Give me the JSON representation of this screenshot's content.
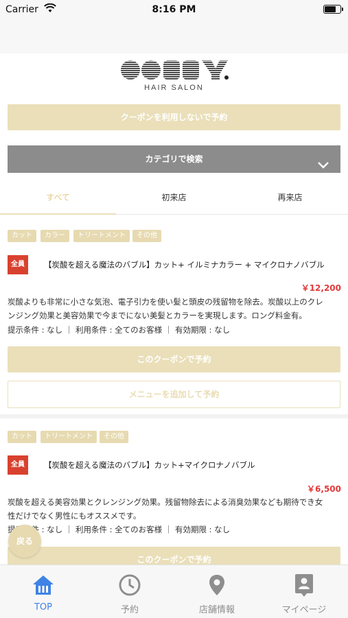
{
  "status": {
    "carrier": "Carrier",
    "time": "8:16 PM"
  },
  "brand": {
    "logo_text": "OORRY.",
    "subtitle": "HAIR SALON"
  },
  "actions": {
    "no_coupon": "クーポンを利用しないで予約",
    "category_search": "カテゴリで検索"
  },
  "tabs": [
    "すべて",
    "初来店",
    "再来店"
  ],
  "coupons": [
    {
      "tags": [
        "カット",
        "カラー",
        "トリートメント",
        "その他"
      ],
      "badge": "全員",
      "title": "【炭酸を超える魔法のバブル】カット+ イルミナカラー + マイクロナノバブル",
      "price": "￥12,200",
      "desc_line1": "炭酸よりも非常に小さな気泡、電子引力を使い髪と頭皮の残留物を除去。炭酸以上のクレ",
      "desc_line2": "ンジング効果と美容効果で今までにない美髪とカラーを実現します。ロング料金有。",
      "conditions": "提示条件 : なし ｜ 利用条件 : 全てのお客様 ｜ 有効期限 : なし",
      "reserve": "このクーポンで予約",
      "add_menu": "メニューを追加して予約"
    },
    {
      "tags": [
        "カット",
        "トリートメント",
        "その他"
      ],
      "badge": "全員",
      "title": "【炭酸を超える魔法のバブル】カット+マイクロナノバブル",
      "price": "￥6,500",
      "desc_line1": "炭酸を超える美容効果とクレンジング効果。残留物除去による消臭効果なども期待でき女",
      "desc_line2": "性だけでなく男性にもオススメです。",
      "conditions": "提示条件 : なし ｜ 利用条件 : 全てのお客様 ｜ 有効期限 : なし",
      "reserve": "このクーポンで予約"
    }
  ],
  "back": "戻る",
  "tabbar": [
    {
      "label": "TOP",
      "icon": "home-icon",
      "active": true
    },
    {
      "label": "予約",
      "icon": "clock-icon",
      "active": false
    },
    {
      "label": "店舗情報",
      "icon": "location-pin-icon",
      "active": false
    },
    {
      "label": "マイページ",
      "icon": "profile-card-icon",
      "active": false
    }
  ],
  "colors": {
    "accent_beige": "#eadfb9",
    "price_red": "#e23a3a",
    "badge_red": "#d9412f",
    "tab_active_blue": "#3f83e6"
  }
}
